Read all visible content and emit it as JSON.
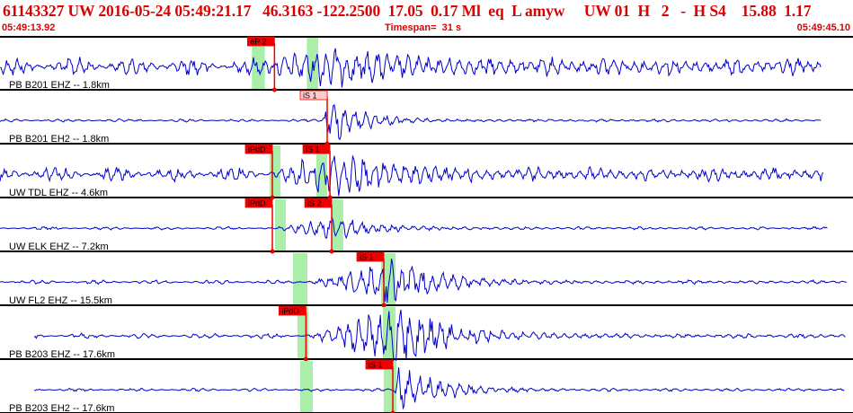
{
  "header": {
    "title": "61143327 UW 2016-05-24 05:49:21.17   46.3163 -122.2500  17.05  0.17 Ml  eq  L amyw     UW 01  H   2   -  H S4    15.88  1.17",
    "start_time": "05:49:13.92",
    "timespan": "Timespan=  31 s",
    "end_time": "05:49:45.10"
  },
  "colors": {
    "trace": "#0000cc",
    "pick_red": "#ee0000",
    "pick_pink": "#ffcccc",
    "window_green": "#aaeeaa",
    "header_red": "#dd0000"
  },
  "channels": [
    {
      "label": "PB B201 EHZ -- 1.8km",
      "picks": [
        {
          "label": "eP 2",
          "t": 0.2986,
          "color": "red"
        }
      ],
      "windows": [
        {
          "t0": 0.2953,
          "t1": 0.3105
        },
        {
          "t0": 0.3598,
          "t1": 0.373
        }
      ],
      "trace": {
        "t0": 0.0,
        "t1": 0.963,
        "noise": 0.18,
        "amp": 0.32,
        "onset": 0.304,
        "peak": 0.388,
        "decay": 0.09
      }
    },
    {
      "label": "PB B201 EH2 -- 1.8km",
      "picks": [
        {
          "label": "iS 1",
          "t": 0.3604,
          "color": "pink"
        }
      ],
      "windows": [],
      "trace": {
        "t0": 0.0,
        "t1": 0.963,
        "noise": 0.03,
        "amp": 0.45,
        "onset": 0.378,
        "peak": 0.385,
        "decay": 0.04
      }
    },
    {
      "label": "UW TDL EHZ -- 4.6km",
      "picks": [
        {
          "label": "iPdD",
          "t": 0.2961,
          "color": "red"
        },
        {
          "label": "iS 1",
          "t": 0.3636,
          "color": "red"
        }
      ],
      "windows": [
        {
          "t0": 0.3161,
          "t1": 0.3287
        },
        {
          "t0": 0.3709,
          "t1": 0.3835
        }
      ],
      "trace": {
        "t0": 0.0,
        "t1": 0.965,
        "noise": 0.14,
        "amp": 0.4,
        "onset": 0.322,
        "peak": 0.392,
        "decay": 0.07
      }
    },
    {
      "label": "UW ELK EHZ -- 7.2km",
      "picks": [
        {
          "label": "iPdD",
          "t": 0.2961,
          "color": "red"
        },
        {
          "label": "iS 2",
          "t": 0.3657,
          "color": "red"
        }
      ],
      "windows": [
        {
          "t0": 0.3224,
          "t1": 0.3351
        },
        {
          "t0": 0.3898,
          "t1": 0.4024
        }
      ],
      "trace": {
        "t0": 0.0,
        "t1": 0.97,
        "noise": 0.03,
        "amp": 0.2,
        "onset": 0.322,
        "peak": 0.395,
        "decay": 0.05
      }
    },
    {
      "label": "UW FL2 EHZ -- 15.5km",
      "picks": [
        {
          "label": "iS 1",
          "t": 0.4268,
          "color": "red"
        }
      ],
      "windows": [
        {
          "t0": 0.3435,
          "t1": 0.3604
        },
        {
          "t0": 0.4468,
          "t1": 0.4636
        }
      ],
      "trace": {
        "t0": 0.0,
        "t1": 0.993,
        "noise": 0.04,
        "amp": 0.4,
        "onset": 0.362,
        "peak": 0.46,
        "decay": 0.06
      }
    },
    {
      "label": "PB B203 EHZ -- 17.6km",
      "picks": [
        {
          "label": "iPdD",
          "t": 0.3355,
          "color": "red"
        }
      ],
      "windows": [
        {
          "t0": 0.3488,
          "t1": 0.3614
        },
        {
          "t0": 0.4488,
          "t1": 0.4636
        }
      ],
      "trace": {
        "t0": 0.04,
        "t1": 0.992,
        "noise": 0.05,
        "amp": 0.55,
        "onset": 0.362,
        "peak": 0.47,
        "decay": 0.06
      }
    },
    {
      "label": "PB B203 EH2 -- 17.6km",
      "picks": [
        {
          "label": "iS 1",
          "t": 0.4373,
          "color": "red"
        }
      ],
      "windows": [
        {
          "t0": 0.3519,
          "t1": 0.3667
        },
        {
          "t0": 0.4499,
          "t1": 0.4647
        }
      ],
      "trace": {
        "t0": 0.04,
        "t1": 0.99,
        "noise": 0.03,
        "amp": 0.45,
        "onset": 0.462,
        "peak": 0.468,
        "decay": 0.05
      }
    }
  ]
}
